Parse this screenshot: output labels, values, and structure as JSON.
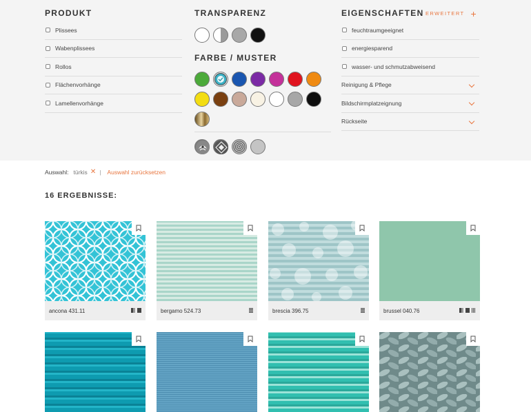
{
  "filters": {
    "produkt": {
      "title": "PRODUKT",
      "items": [
        "Plissees",
        "Wabenplissees",
        "Rollos",
        "Flächenvorhänge",
        "Lamellenvorhänge"
      ]
    },
    "transparenz": {
      "title": "TRANSPARENZ",
      "swatches": [
        {
          "name": "transparent",
          "color": "#ffffff"
        },
        {
          "name": "halbtransparent",
          "color": "half"
        },
        {
          "name": "lichtundurchlässig",
          "color": "#a8a8a8"
        },
        {
          "name": "verdunkelnd",
          "color": "#111111"
        }
      ]
    },
    "farbe": {
      "title": "FARBE / MUSTER",
      "colors": [
        {
          "name": "grün",
          "color": "#4caa3a"
        },
        {
          "name": "türkis",
          "color": "#3ab0c4",
          "selected": true
        },
        {
          "name": "blau",
          "color": "#1a56b0"
        },
        {
          "name": "lila",
          "color": "#7b2aa5"
        },
        {
          "name": "pink",
          "color": "#c4319a"
        },
        {
          "name": "rot",
          "color": "#e0141f"
        },
        {
          "name": "orange",
          "color": "#ef8a12"
        },
        {
          "name": "gelb",
          "color": "#f3dd12"
        },
        {
          "name": "braun",
          "color": "#7a4010"
        },
        {
          "name": "beige",
          "color": "#c9a99a"
        },
        {
          "name": "creme",
          "color": "#f8f2e4"
        },
        {
          "name": "weiß",
          "color": "#ffffff"
        },
        {
          "name": "grau",
          "color": "#a7a7a7"
        },
        {
          "name": "schwarz",
          "color": "#0e0e0e"
        },
        {
          "name": "metallic",
          "color": "gold"
        }
      ],
      "patterns": [
        {
          "name": "floral"
        },
        {
          "name": "geometrisch"
        },
        {
          "name": "gepunktet"
        },
        {
          "name": "uni"
        }
      ]
    },
    "eigenschaften": {
      "title": "EIGENSCHAFTEN",
      "extended_label": "ERWEITERT",
      "checks": [
        "feuchtraumgeeignet",
        "energiesparend",
        "wasser- und schmutzabweisend"
      ],
      "dropdowns": [
        "Reinigung & Pflege",
        "Bildschirmplatzeignung",
        "Rückseite"
      ]
    }
  },
  "selection": {
    "label": "Auswahl:",
    "chip": "türkis",
    "remove": "✕",
    "separator": "|",
    "reset": "Auswahl zurücksetzen"
  },
  "results_title": "16 ERGEBNISSE:",
  "products": [
    {
      "name": "ancona 431.11",
      "icons": [
        "half",
        "solid"
      ]
    },
    {
      "name": "bergamo 524.73",
      "icons": [
        "grid"
      ]
    },
    {
      "name": "brescia 396.75",
      "icons": [
        "grid"
      ]
    },
    {
      "name": "brussel 040.76",
      "icons": [
        "half",
        "solid",
        "lines"
      ]
    },
    {
      "name": "",
      "icons": []
    },
    {
      "name": "",
      "icons": []
    },
    {
      "name": "",
      "icons": []
    },
    {
      "name": "",
      "icons": []
    }
  ]
}
